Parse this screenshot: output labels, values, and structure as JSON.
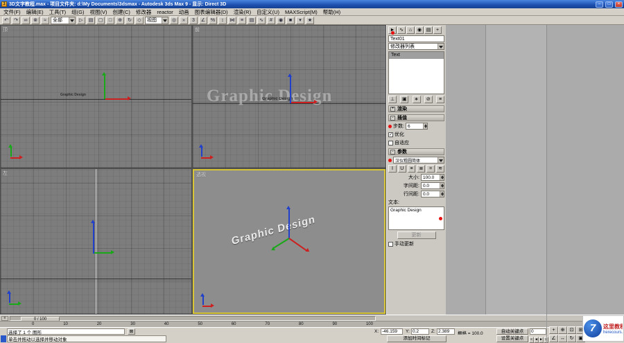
{
  "window": {
    "app_icon_label": "3",
    "title": "3D文字教程.max - 项目文件夹: d:\\My Documents\\3dsmax  - Autodesk 3ds Max 9 - 显示: Direct 3D",
    "minimize": "–",
    "maximize": "□",
    "close": "×"
  },
  "menubar": {
    "items": [
      "文件(F)",
      "编辑(E)",
      "工具(T)",
      "组(G)",
      "视图(V)",
      "创建(C)",
      "修改器",
      "reactor",
      "动画",
      "图表编辑器(D)",
      "渲染(R)",
      "自定义(U)",
      "MAXScript(M)",
      "帮助(H)"
    ]
  },
  "toolbar": {
    "selection_filter": "全部",
    "coord_system": "视图",
    "icons_a": [
      {
        "name": "undo-icon",
        "glyph": "↶"
      },
      {
        "name": "redo-icon",
        "glyph": "↷"
      },
      {
        "name": "select-and-link-icon",
        "glyph": "∞"
      },
      {
        "name": "unlink-selection-icon",
        "glyph": "⊗"
      },
      {
        "name": "bind-to-space-warp-icon",
        "glyph": "≈"
      }
    ],
    "icons_b": [
      {
        "name": "select-object-icon",
        "glyph": "▷"
      },
      {
        "name": "select-by-name-icon",
        "glyph": "▤"
      },
      {
        "name": "rectangular-selection-region-icon",
        "glyph": "▢"
      },
      {
        "name": "window-crossing-toggle-icon",
        "glyph": "□"
      },
      {
        "name": "select-and-move-icon",
        "glyph": "⊕"
      },
      {
        "name": "select-and-rotate-icon",
        "glyph": "↻"
      },
      {
        "name": "select-and-scale-icon",
        "glyph": "◇"
      }
    ],
    "icons_c": [
      {
        "name": "use-pivot-center-icon",
        "glyph": "◎"
      },
      {
        "name": "select-and-manipulate-icon",
        "glyph": "»"
      },
      {
        "name": "snaps-toggle-icon",
        "glyph": "3"
      },
      {
        "name": "angle-snap-icon",
        "glyph": "∠"
      },
      {
        "name": "percent-snap-icon",
        "glyph": "%"
      },
      {
        "name": "spinner-snap-icon",
        "glyph": "↕"
      },
      {
        "name": "mirror-icon",
        "glyph": "⋈"
      },
      {
        "name": "align-icon",
        "glyph": "≡"
      },
      {
        "name": "layer-manager-icon",
        "glyph": "▤"
      },
      {
        "name": "curve-editor-icon",
        "glyph": "∿"
      },
      {
        "name": "schematic-view-icon",
        "glyph": "#"
      },
      {
        "name": "material-editor-icon",
        "glyph": "◉"
      },
      {
        "name": "render-scene-icon",
        "glyph": "■"
      },
      {
        "name": "render-type-icon",
        "glyph": "▾"
      },
      {
        "name": "quick-render-icon",
        "glyph": "★"
      }
    ]
  },
  "viewports": {
    "top": {
      "label": "顶",
      "spline_text": "Graphic Design"
    },
    "front": {
      "label": "前",
      "spline_text": "Graphic Design",
      "watermark_text": "Graphic Design"
    },
    "left": {
      "label": "左"
    },
    "perspective": {
      "label": "透视",
      "spline_text": "Graphic Design"
    }
  },
  "command_panel": {
    "tabs": [
      {
        "name": "tab-create-icon",
        "glyph": "►"
      },
      {
        "name": "tab-modify-icon",
        "glyph": "∿"
      },
      {
        "name": "tab-hierarchy-icon",
        "glyph": "⌂"
      },
      {
        "name": "tab-motion-icon",
        "glyph": "◉"
      },
      {
        "name": "tab-display-icon",
        "glyph": "▤"
      },
      {
        "name": "tab-utilities-icon",
        "glyph": "+"
      }
    ],
    "object_name": "Text01",
    "modifier_list_label": "修改器列表",
    "stack": {
      "items": [
        "Text"
      ]
    },
    "stack_buttons": [
      {
        "name": "pin-stack-button",
        "glyph": "⊥"
      },
      {
        "name": "show-end-result-button",
        "glyph": "▣"
      },
      {
        "name": "make-unique-button",
        "glyph": "∗"
      },
      {
        "name": "remove-modifier-button",
        "glyph": "⊘"
      },
      {
        "name": "configure-modifier-sets-button",
        "glyph": "≡"
      }
    ],
    "rendering": {
      "title": "渲染",
      "toggle": "+"
    },
    "interpolation": {
      "title": "插值",
      "toggle": "-",
      "steps_label": "步数:",
      "steps_value": "6",
      "optimize_label": "优化",
      "optimize_check": "✓",
      "adaptive_label": "自适应"
    },
    "parameters": {
      "title": "参数",
      "toggle": "-",
      "font_name": "汉仪粗圆简体",
      "style_buttons": [
        {
          "name": "italic-button",
          "glyph": "I"
        },
        {
          "name": "underline-button",
          "glyph": "U"
        },
        {
          "name": "align-left-button",
          "glyph": "≡"
        },
        {
          "name": "align-center-button",
          "glyph": "≣"
        },
        {
          "name": "align-right-button",
          "glyph": "="
        },
        {
          "name": "justify-button",
          "glyph": "≋"
        }
      ],
      "size_label": "大小:",
      "size_value": "100.0",
      "kerning_label": "字间距:",
      "kerning_value": "0.0",
      "leading_label": "行间距:",
      "leading_value": "0.0",
      "text_label": "文本:",
      "text_value": "Graphic Design",
      "update_button": "更新",
      "manual_update_label": "手动更新"
    }
  },
  "timeline": {
    "mini_glyph": "≡",
    "slider_label": "0 / 100",
    "ticks": [
      "0",
      "10",
      "20",
      "30",
      "40",
      "50",
      "60",
      "70",
      "80",
      "90",
      "100"
    ]
  },
  "status": {
    "selection": "选择了 1 个 图形",
    "prompt": "单击并拖动以选择并移动对象",
    "lock_glyph": "⊠",
    "x_label": "X:",
    "x_value": "-46.159",
    "y_label": "Y:",
    "y_value": "0.2",
    "z_label": "Z:",
    "z_value": "2.389",
    "grid": "栅格 = 100.0",
    "auto_key": "自动关键点",
    "set_key": "设置关键点",
    "add_time_tag": "添加时间标记",
    "frame": "0",
    "playback_icons": [
      {
        "name": "go-to-start-icon",
        "glyph": "«"
      },
      {
        "name": "previous-frame-icon",
        "glyph": "◄"
      },
      {
        "name": "play-icon",
        "glyph": "►"
      },
      {
        "name": "go-to-end-icon",
        "glyph": "»"
      }
    ],
    "nav_icons": [
      {
        "name": "zoom-icon",
        "glyph": "+"
      },
      {
        "name": "zoom-all-icon",
        "glyph": "⊕"
      },
      {
        "name": "zoom-extents-icon",
        "glyph": "⊡"
      },
      {
        "name": "zoom-extents-all-icon",
        "glyph": "⊞"
      },
      {
        "name": "field-of-view-icon",
        "glyph": "∠"
      },
      {
        "name": "pan-icon",
        "glyph": "↔"
      },
      {
        "name": "arc-rotate-icon",
        "glyph": "↻"
      },
      {
        "name": "maximize-viewport-toggle-icon",
        "glyph": "▣"
      }
    ]
  },
  "watermark": {
    "logo_glyph": "7",
    "site_name": "这里教程网",
    "site_url": "herecours.com"
  },
  "colors": {
    "active_viewport_border": "#d9c636",
    "axis_x": "#cc2020",
    "axis_y": "#18a818",
    "axis_z": "#2040cc",
    "annotation_dot": "#e81010",
    "titlebar_blue": "#1c4fb0"
  }
}
